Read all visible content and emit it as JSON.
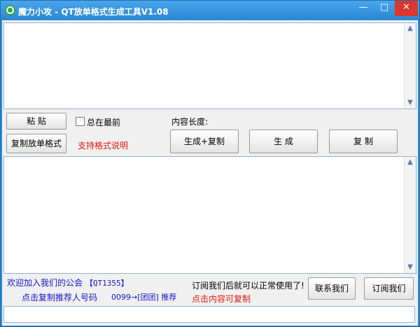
{
  "window": {
    "title": "魔力小攻 - QT放单格式生成工具V1.08",
    "minimize_glyph": "—",
    "maximize_glyph": "□",
    "close_glyph": "✕",
    "icon": "app-logo-icon",
    "accent_color": "#2f8fd8"
  },
  "input_area": {
    "value": ""
  },
  "controls": {
    "paste_label": "粘 贴",
    "always_on_top_label": "总在最前",
    "always_on_top_checked": false,
    "content_length_label": "内容长度:",
    "copy_order_format_label": "复制放单格式",
    "supported_format_link": "支持格式说明",
    "generate_copy_label": "生成+复制",
    "generate_label": "生 成",
    "copy_label": "复 制"
  },
  "output_area": {
    "value": ""
  },
  "footer": {
    "welcome_text": "欢迎加入我们的公会",
    "guild_code": "【QT1355】",
    "copy_referrer_link": "点击复制推荐人号码",
    "recommend_text": "0099→[团团] 推荐",
    "subscribe_notice": "订阅我们后就可以正常使用了!",
    "click_copy_hint": "点击内容可复制",
    "contact_button": "联系我们",
    "subscribe_button": "订阅我们"
  },
  "status_bar": {
    "value": ""
  },
  "scroll_icons": {
    "up": "▲",
    "down": "▼"
  }
}
